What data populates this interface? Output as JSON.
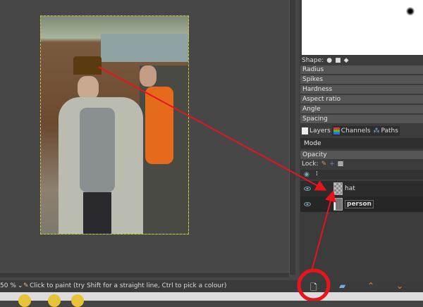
{
  "tool_options": {
    "shape_label": "Shape:",
    "rows": [
      "Radius",
      "Spikes",
      "Hardness",
      "Aspect ratio",
      "Angle",
      "Spacing"
    ]
  },
  "tabs": [
    "Layers",
    "Channels",
    "Paths"
  ],
  "layers_panel": {
    "mode_label": "Mode",
    "opacity_label": "Opacity",
    "lock_label": "Lock:"
  },
  "layers": [
    {
      "name": "hat"
    },
    {
      "name": "person"
    }
  ],
  "status": {
    "zoom": "50 %",
    "message": "Click to paint (try Shift for a straight line, Ctrl to pick a colour)"
  },
  "colors": {
    "annotation": "#e8141c",
    "panel": "#3c3c3c",
    "row": "#555555"
  }
}
